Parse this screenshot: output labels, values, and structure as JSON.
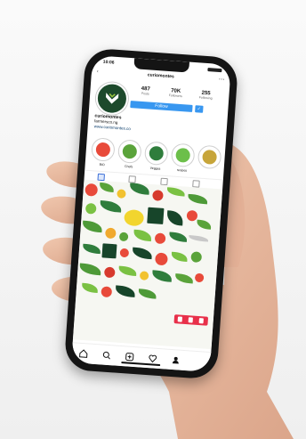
{
  "status_bar": {
    "time": "10:06"
  },
  "profile": {
    "username": "curiomontes",
    "display_name": "curiomontes",
    "bio": "farmersco.ng",
    "link": "www.curiomontes.co",
    "follow_label": "Follow",
    "more_label": "✓",
    "stats": [
      {
        "value": "487",
        "label": "Posts"
      },
      {
        "value": "70K",
        "label": "Followers"
      },
      {
        "value": "255",
        "label": "Following"
      }
    ]
  },
  "highlights": [
    {
      "label": "BIO",
      "color": "#e84a3a"
    },
    {
      "label": "Chefs",
      "color": "#5aa33a"
    },
    {
      "label": "Vegges",
      "color": "#2f7d3c"
    },
    {
      "label": "recipes",
      "color": "#6cbf4a"
    },
    {
      "label": "",
      "color": "#c7a53a"
    }
  ],
  "colors": {
    "brand_green": "#1d4a2c",
    "follow_blue": "#3897f0",
    "action_red": "#e8304a"
  },
  "icons": [
    "back-icon",
    "more-icon",
    "grid-icon",
    "tagged-icon",
    "home-icon",
    "search-icon",
    "add-icon",
    "heart-icon",
    "profile-icon"
  ]
}
